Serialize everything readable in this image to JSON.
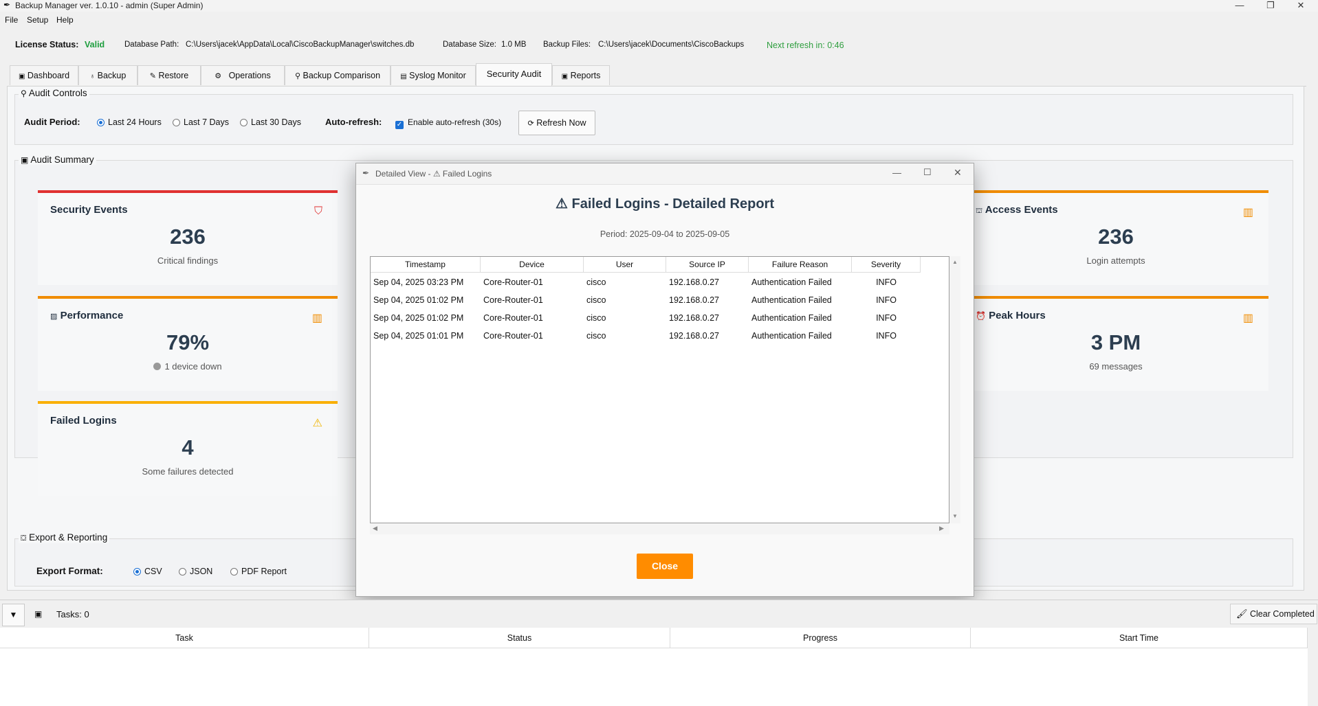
{
  "window": {
    "title": "Backup Manager ver. 1.0.10 - admin (Super Admin)",
    "controls": [
      "—",
      "❐",
      "✕"
    ]
  },
  "menu": [
    "File",
    "Setup",
    "Help"
  ],
  "status": {
    "license_label": "License Status:",
    "license_value": "Valid",
    "db_path_label": "Database Path:",
    "db_path_value": "C:\\Users\\jacek\\AppData\\Local\\CiscoBackupManager\\switches.db",
    "db_size_label": "Database Size:",
    "db_size_value": "1.0 MB",
    "backup_files_label": "Backup Files:",
    "backup_files_value": "C:\\Users\\jacek\\Documents\\CiscoBackups",
    "refresh": "Next refresh in: 0:46",
    "colors": {
      "valid": "#1e9e3e",
      "refresh": "#2e9e3e"
    }
  },
  "tabs": [
    {
      "label": "Dashboard",
      "icon": "clipboard-icon"
    },
    {
      "label": "Backup",
      "icon": "bulb-icon"
    },
    {
      "label": "Restore",
      "icon": "wrench-icon"
    },
    {
      "label": "Operations",
      "icon": "gear-icon"
    },
    {
      "label": "Backup Comparison",
      "icon": "search-icon"
    },
    {
      "label": "Syslog Monitor",
      "icon": "document-icon"
    },
    {
      "label": "Security Audit",
      "icon": ""
    },
    {
      "label": "Reports",
      "icon": "clipboard-icon"
    }
  ],
  "audit_controls": {
    "title": "Audit Controls",
    "period_label": "Audit Period:",
    "periods": [
      "Last 24 Hours",
      "Last 7 Days",
      "Last 30 Days"
    ],
    "selected_period": "Last 24 Hours",
    "auto_label": "Auto-refresh:",
    "auto_checkbox": "Enable auto-refresh (30s)",
    "auto_checked": true,
    "refresh_button": "Refresh Now"
  },
  "summary": {
    "title": "Audit Summary",
    "cards": {
      "security": {
        "title": "Security Events",
        "value": "236",
        "sub": "Critical findings",
        "accent": "#e03131",
        "icon": "shield-icon"
      },
      "performance": {
        "title": "Performance",
        "value": "79%",
        "sub": "1 device down",
        "accent": "#f08c00",
        "icon": "bar-chart-icon"
      },
      "failed": {
        "title": "Failed Logins",
        "value": "4",
        "sub": "Some failures detected",
        "accent": "#fab005",
        "icon": "warning-icon"
      },
      "access": {
        "title": "Access Events",
        "value": "236",
        "sub": "Login attempts",
        "accent": "#f08c00",
        "icon": "bar-chart-icon"
      },
      "peak": {
        "title": "Peak Hours",
        "value": "3 PM",
        "sub": "69 messages",
        "accent": "#f08c00",
        "icon": "bar-chart-icon"
      }
    }
  },
  "export": {
    "title": "Export & Reporting",
    "format_label": "Export Format:",
    "formats": [
      "CSV",
      "JSON",
      "PDF Report"
    ],
    "selected": "CSV"
  },
  "modal": {
    "title": "Detailed View - ⚠ Failed Logins",
    "heading": "Failed Logins - Detailed Report",
    "period": "Period: 2025-09-04 to 2025-09-05",
    "columns": [
      "Timestamp",
      "Device",
      "User",
      "Source IP",
      "Failure Reason",
      "Severity"
    ],
    "rows": [
      [
        "Sep 04, 2025 03:23 PM",
        "Core-Router-01",
        "cisco",
        "192.168.0.27",
        "Authentication Failed",
        "INFO"
      ],
      [
        "Sep 04, 2025 01:02 PM",
        "Core-Router-01",
        "cisco",
        "192.168.0.27",
        "Authentication Failed",
        "INFO"
      ],
      [
        "Sep 04, 2025 01:02 PM",
        "Core-Router-01",
        "cisco",
        "192.168.0.27",
        "Authentication Failed",
        "INFO"
      ],
      [
        "Sep 04, 2025 01:01 PM",
        "Core-Router-01",
        "cisco",
        "192.168.0.27",
        "Authentication Failed",
        "INFO"
      ]
    ],
    "close_button": "Close",
    "close_color": "#ff8c00"
  },
  "task_panel": {
    "count": "Tasks: 0",
    "clear_button": "Clear Completed",
    "columns": [
      "Task",
      "Status",
      "Progress",
      "Start Time"
    ]
  }
}
